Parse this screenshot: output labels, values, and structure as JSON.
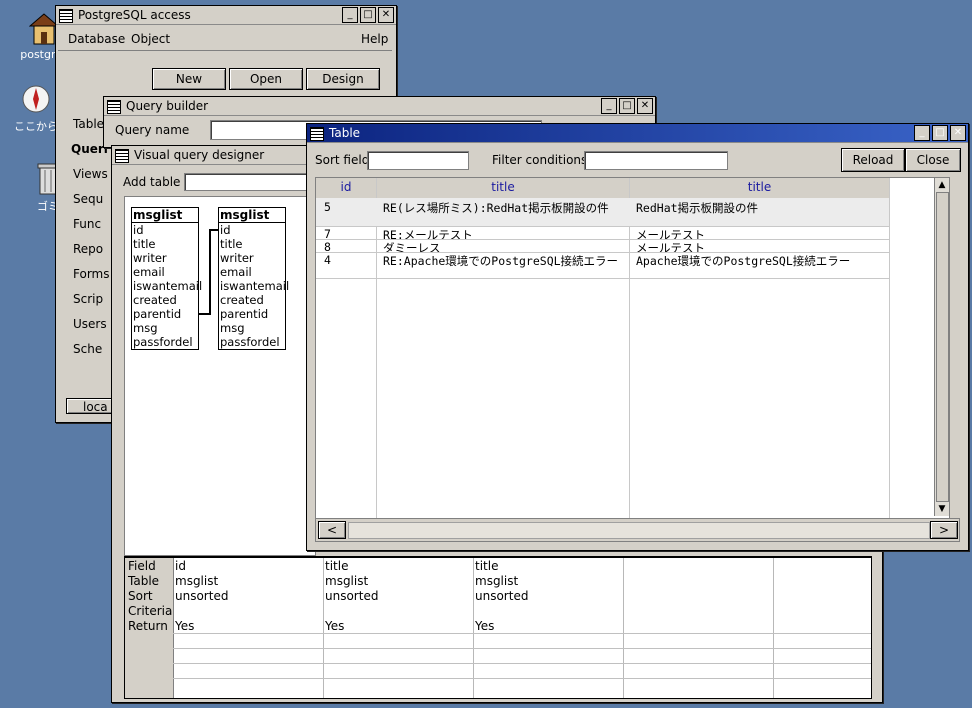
{
  "desktop": {
    "icons": [
      {
        "label": "postgres",
        "icon": "house-icon"
      },
      {
        "label": "ここから",
        "icon": "compass-icon"
      },
      {
        "label": "ゴミ",
        "icon": "trash-icon"
      }
    ]
  },
  "pg_access": {
    "title": "PostgreSQL access",
    "menu": {
      "database": "Database",
      "object": "Object",
      "help": "Help"
    },
    "buttons": {
      "new": "New",
      "open": "Open",
      "design": "Design"
    },
    "sidebar": [
      "Table",
      "Queri",
      "Views",
      "Sequ",
      "Func",
      "Repo",
      "Forms",
      "Scrip",
      "Users",
      "Sche"
    ],
    "status": "loca"
  },
  "query_builder": {
    "title": "Query builder",
    "query_name_label": "Query name",
    "query_name_value": ""
  },
  "designer": {
    "title": "Visual query designer",
    "add_table_label": "Add table",
    "tables": [
      {
        "name": "msglist",
        "fields": [
          "id",
          "title",
          "writer",
          "email",
          "iswantemail",
          "created",
          "parentid",
          "msg",
          "passfordel"
        ]
      },
      {
        "name": "msglist",
        "fields": [
          "id",
          "title",
          "writer",
          "email",
          "iswantemail",
          "created",
          "parentid",
          "msg",
          "passfordel"
        ]
      }
    ],
    "grid": {
      "row_labels": [
        "Field",
        "Table",
        "Sort",
        "Criteria",
        "Return"
      ],
      "columns": [
        {
          "field": "id",
          "table": "msglist",
          "sort": "unsorted",
          "criteria": "",
          "return": "Yes"
        },
        {
          "field": "title",
          "table": "msglist",
          "sort": "unsorted",
          "criteria": "",
          "return": "Yes"
        },
        {
          "field": "title",
          "table": "msglist",
          "sort": "unsorted",
          "criteria": "",
          "return": "Yes"
        }
      ]
    }
  },
  "table_win": {
    "title": "Table",
    "sort_field_label": "Sort field",
    "sort_field_value": "",
    "filter_label": "Filter conditions",
    "filter_value": "",
    "reload": "Reload",
    "close": "Close",
    "headers": [
      "id",
      "title",
      "title"
    ],
    "rows": [
      [
        "5",
        "RE(レス場所ミス):RedHat掲示板開設の件",
        "RedHat掲示板開設の件"
      ],
      [
        "7",
        "RE:メールテスト",
        "メールテスト"
      ],
      [
        "8",
        "ダミーレス",
        "メールテスト"
      ],
      [
        "4",
        "RE:Apache環境でのPostgreSQL接続エラー",
        "Apache環境でのPostgreSQL接続エラー"
      ]
    ],
    "scroll_left": "<",
    "scroll_right": ">"
  },
  "colors": {
    "desktop": "#5a7ba6",
    "window": "#d4d0c8",
    "active_title": "#0c2480",
    "header_text": "#1a1aa0"
  }
}
